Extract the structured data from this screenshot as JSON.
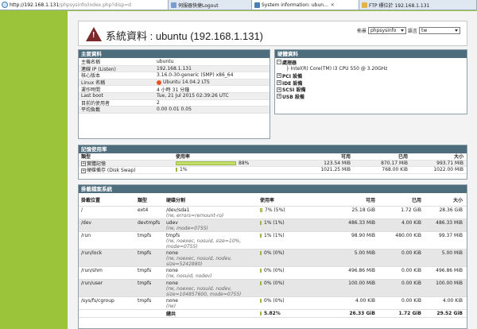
{
  "browser": {
    "url_main": "http://192.168.1.131",
    "url_rest": "/phpsysinfo/index.php?disp=d",
    "tabs": [
      {
        "label": "伺服器快捷Logout",
        "active": false,
        "color": "#7a9bd0"
      },
      {
        "label": "System information: ubun...",
        "active": true,
        "color": "#4a7fb5"
      },
      {
        "label": "FTP 標位於 192.168.1.131",
        "active": false,
        "color": "#e6b04a"
      }
    ]
  },
  "header": {
    "warn_glyph": "!",
    "title": "系統資料 : ubuntu (192.168.1.131)",
    "template_label": "佈景",
    "template_value": "phpsysinfo",
    "lang_label": "語言",
    "lang_value": "tw"
  },
  "vitals": {
    "title": "主要資料",
    "rows": [
      {
        "label": "主機名稱",
        "value": "ubuntu"
      },
      {
        "label": "連線 IP (Listen)",
        "value": "192.168.1.131"
      },
      {
        "label": "核心版本",
        "value": "3.16.0-30-generic (SMP) x86_64"
      },
      {
        "label": "Linux 名稱",
        "value": "Ubuntu 14.04.2 LTS"
      },
      {
        "label": "運作時間",
        "value": "4 小時 31 分鐘"
      },
      {
        "label": "Last boot",
        "value": "Tue, 21 Jul 2015 02:39:26 UTC"
      },
      {
        "label": "目前的使用者",
        "value": "2"
      },
      {
        "label": "平均負載",
        "value": "0.00 0.01 0.05"
      }
    ]
  },
  "hardware": {
    "title": "硬體資料",
    "processor_label": "處理器",
    "processor_value": "Intel(R) Core(TM) i3 CPU 550 @ 3.20GHz",
    "items": [
      "PCI 設備",
      "IDE 設備",
      "SCSI 設備",
      "USB 設備"
    ]
  },
  "memory": {
    "title": "記憶使用率",
    "headers": {
      "type": "類型",
      "usage": "使用率",
      "free": "可用",
      "used": "已用",
      "size": "大小"
    },
    "rows": [
      {
        "type": "實體記憶",
        "usage_pct": 88,
        "usage_label": "88%",
        "free": "123.54 MiB",
        "used": "870.17 MiB",
        "size": "993.71 MiB"
      },
      {
        "type": "硬碟備存 (Disk Swap)",
        "usage_pct": 1,
        "usage_label": "1%",
        "free": "1021.25 MiB",
        "used": "768.00 KiB",
        "size": "1022.00 MiB"
      }
    ]
  },
  "filesystems": {
    "title": "掛載檔案系統",
    "headers": {
      "mount": "掛載位置",
      "type": "類型",
      "partition": "硬碟分割",
      "usage": "使用率",
      "free": "可用",
      "used": "已用",
      "size": "大小"
    },
    "rows": [
      {
        "mount": "/",
        "type": "ext4",
        "partition": "/dev/sda1",
        "options": "(rw, errors=remount-ro)",
        "usage_pct": 7,
        "usage_label": "7% (5%)",
        "free": "25.18 GiB",
        "used": "1.72 GiB",
        "size": "28.36 GiB"
      },
      {
        "mount": "/dev",
        "type": "devtmpfs",
        "partition": "udev",
        "options": "(rw, mode=0755)",
        "usage_pct": 1,
        "usage_label": "1% (1%)",
        "free": "486.33 MiB",
        "used": "4.00 KiB",
        "size": "486.33 MiB"
      },
      {
        "mount": "/run",
        "type": "tmpfs",
        "partition": "tmpfs",
        "options": "(rw, noexec, nosuid, size=10%, mode=0755)",
        "usage_pct": 1,
        "usage_label": "1% (1%)",
        "free": "98.90 MiB",
        "used": "480.00 KiB",
        "size": "99.37 MiB"
      },
      {
        "mount": "/run/lock",
        "type": "tmpfs",
        "partition": "none",
        "options": "(rw, noexec, nosuid, nodev, size=5242880)",
        "usage_pct": 0,
        "usage_label": "0% (0%)",
        "free": "5.00 MiB",
        "used": "0.00 KiB",
        "size": "5.00 MiB"
      },
      {
        "mount": "/run/shm",
        "type": "tmpfs",
        "partition": "none",
        "options": "(rw, nosuid, nodev)",
        "usage_pct": 0,
        "usage_label": "0% (0%)",
        "free": "496.86 MiB",
        "used": "0.00 KiB",
        "size": "496.86 MiB"
      },
      {
        "mount": "/run/user",
        "type": "tmpfs",
        "partition": "none",
        "options": "(rw, noexec, nosuid, nodev, size=104857600, mode=0755)",
        "usage_pct": 0,
        "usage_label": "0% (0%)",
        "free": "100.00 MiB",
        "used": "0.00 KiB",
        "size": "100.00 MiB"
      },
      {
        "mount": "/sys/fs/cgroup",
        "type": "tmpfs",
        "partition": "none",
        "options": "(rw)",
        "usage_pct": 0,
        "usage_label": "0% (0%)",
        "free": "4.00 KiB",
        "used": "0.00 KiB",
        "size": "4.00 KiB"
      }
    ],
    "total": {
      "label": "總共",
      "usage_pct": 5.82,
      "usage_label": "5.82%",
      "free": "26.33 GiB",
      "used": "1.72 GiB",
      "size": "29.52 GiB"
    }
  }
}
